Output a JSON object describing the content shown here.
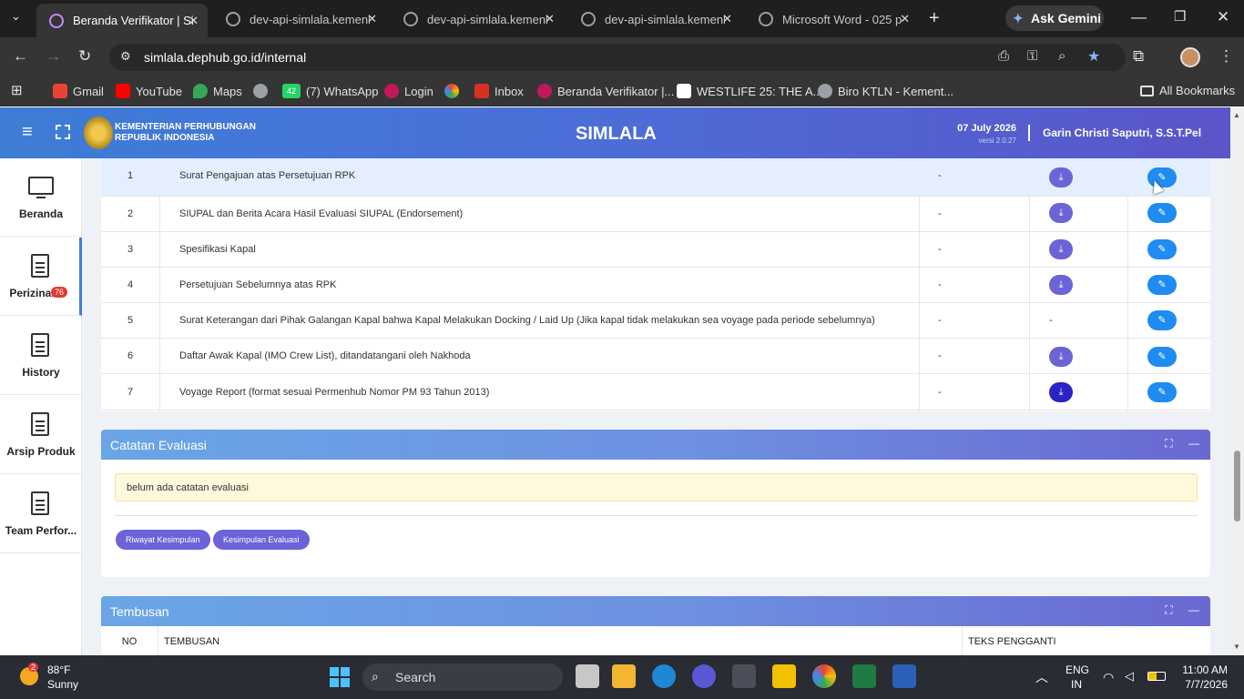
{
  "browser": {
    "tabs": [
      {
        "title": "Beranda Verifikator | Si",
        "active": true
      },
      {
        "title": "dev-api-simlala.kemenl",
        "active": false
      },
      {
        "title": "dev-api-simlala.kemenl",
        "active": false
      },
      {
        "title": "dev-api-simlala.kemenl",
        "active": false
      },
      {
        "title": "Microsoft Word - 025 p",
        "active": false
      }
    ],
    "ask_gemini": "Ask Gemini",
    "url": "simlala.dephub.go.id/internal",
    "bookmarks": [
      {
        "label": "Gmail",
        "color": "#ea4335"
      },
      {
        "label": "YouTube",
        "color": "#ff0000"
      },
      {
        "label": "Maps",
        "color": "#34a853"
      },
      {
        "label": "",
        "color": "#9aa0a6"
      },
      {
        "label": "(7) WhatsApp",
        "badge": "42",
        "color": "#25d366"
      },
      {
        "label": "Login",
        "color": "#c2185b"
      },
      {
        "label": "",
        "color": "#fbbc04"
      },
      {
        "label": "Inbox",
        "color": "#d93025"
      },
      {
        "label": "Beranda Verifikator |...",
        "color": "#c2185b"
      },
      {
        "label": "WESTLIFE 25: THE A...",
        "color": "#ffffff"
      },
      {
        "label": "Biro KTLN - Kement...",
        "color": "#9aa0a6"
      }
    ],
    "all_bookmarks": "All Bookmarks"
  },
  "header": {
    "org_line1": "KEMENTERIAN PERHUBUNGAN",
    "org_line2": "REPUBLIK INDONESIA",
    "app_name": "SIMLALA",
    "date": "07 July 2026",
    "version": "versi 2.0.27",
    "user": "Garin Christi Saputri, S.S.T.Pel"
  },
  "sidebar": {
    "items": [
      {
        "label": "Beranda",
        "badge": ""
      },
      {
        "label": "Perizinan",
        "badge": "76"
      },
      {
        "label": "History",
        "badge": ""
      },
      {
        "label": "Arsip Produk",
        "badge": ""
      },
      {
        "label": "Team Perfor...",
        "badge": ""
      }
    ]
  },
  "documents": {
    "rows": [
      {
        "no": "1",
        "title": "Surat Pengajuan atas Persetujuan RPK",
        "status": "-",
        "download": true
      },
      {
        "no": "2",
        "title": "SIUPAL dan Berita Acara Hasil Evaluasi SIUPAL (Endorsement)",
        "status": "-",
        "download": true
      },
      {
        "no": "3",
        "title": "Spesifikasi Kapal",
        "status": "-",
        "download": true
      },
      {
        "no": "4",
        "title": "Persetujuan Sebelumnya atas RPK",
        "status": "-",
        "download": true
      },
      {
        "no": "5",
        "title": "Surat Keterangan dari Pihak Galangan Kapal bahwa Kapal Melakukan Docking / Laid Up (Jika kapal tidak melakukan sea voyage pada periode sebelumnya)",
        "status": "-",
        "download": false,
        "download_text": "-"
      },
      {
        "no": "6",
        "title": "Daftar Awak Kapal (IMO Crew List), ditandatangani oleh Nakhoda",
        "status": "-",
        "download": true
      },
      {
        "no": "7",
        "title": "Voyage Report (format sesuai Permenhub Nomor PM 93 Tahun 2013)",
        "status": "-",
        "download": true
      }
    ]
  },
  "catatan": {
    "title": "Catatan Evaluasi",
    "note": "belum ada catatan evaluasi",
    "btn_riwayat": "Riwayat Kesimpulan",
    "btn_kesimpulan": "Kesimpulan Evaluasi"
  },
  "tembusan": {
    "title": "Tembusan",
    "col_no": "NO",
    "col_tembusan": "TEMBUSAN",
    "col_teks": "TEKS PENGGANTI"
  },
  "taskbar": {
    "weather_temp": "88°F",
    "weather_desc": "Sunny",
    "weather_badge": "2",
    "search": "Search",
    "lang1": "ENG",
    "lang2": "IN",
    "time": "11:00 AM",
    "date": "7/7/2026"
  }
}
